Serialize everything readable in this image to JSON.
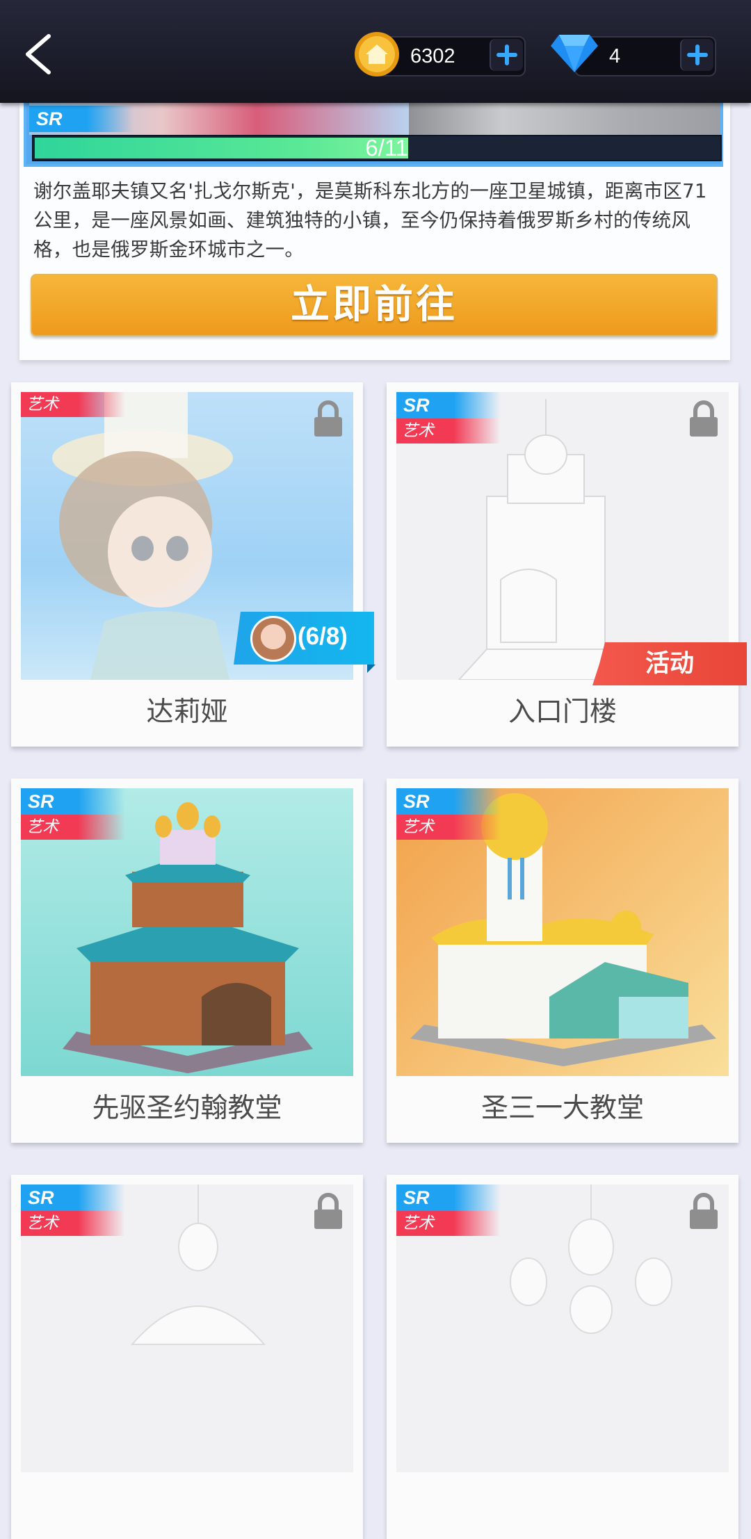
{
  "header": {
    "coins": "6302",
    "gems": "4"
  },
  "banner": {
    "tag_sr": "SR",
    "progress": {
      "current": 6,
      "total": 11,
      "label": "6/11"
    },
    "description": "谢尔盖耶夫镇又名'扎戈尔斯克'，是莫斯科东北方的一座卫星城镇，距离市区71公里，是一座风景如画、建筑独特的小镇，至今仍保持着俄罗斯乡村的传统风格，也是俄罗斯金环城市之一。",
    "button_label": "立即前往"
  },
  "cards": [
    {
      "name": "达莉娅",
      "art_tag": "艺术",
      "locked": true,
      "progress_label": "(6/8)"
    },
    {
      "name": "入口门楼",
      "sr_tag": "SR",
      "art_tag": "艺术",
      "locked": true,
      "event_label": "活动"
    },
    {
      "name": "先驱圣约翰教堂",
      "sr_tag": "SR",
      "art_tag": "艺术",
      "locked": false
    },
    {
      "name": "圣三一大教堂",
      "sr_tag": "SR",
      "art_tag": "艺术",
      "locked": false
    },
    {
      "name": "",
      "sr_tag": "SR",
      "art_tag": "艺术",
      "locked": true
    },
    {
      "name": "",
      "sr_tag": "SR",
      "art_tag": "艺术",
      "locked": true
    }
  ],
  "colors": {
    "accent_orange": "#f0a22a",
    "sr_blue": "#1fa2f2",
    "art_red": "#f23a55",
    "progress_green": "#4ee39a",
    "event_red": "#ec4e40"
  },
  "icons": [
    "back-arrow-icon",
    "coin-icon",
    "gem-icon",
    "plus-icon",
    "lock-icon",
    "avatar-icon"
  ]
}
